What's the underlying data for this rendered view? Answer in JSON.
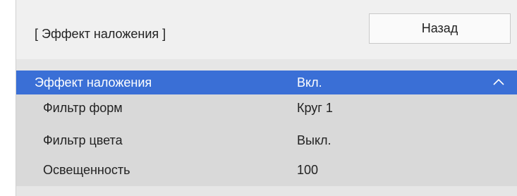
{
  "header": {
    "title": "[ Эффект наложения ]",
    "back_label": "Назад"
  },
  "menu": {
    "items": [
      {
        "label": "Эффект наложения",
        "value": "Вкл."
      },
      {
        "label": "Фильтр форм",
        "value": "Круг 1"
      },
      {
        "label": "Фильтр цвета",
        "value": "Выкл."
      },
      {
        "label": "Освещенность",
        "value": "100"
      }
    ],
    "selected_index": 0
  },
  "icons": {
    "collapse": "chevron-up-icon"
  },
  "colors": {
    "selected_row": "#3a6fd6",
    "list_background": "#d9d9d9",
    "header_background": "#f0f0f0"
  }
}
